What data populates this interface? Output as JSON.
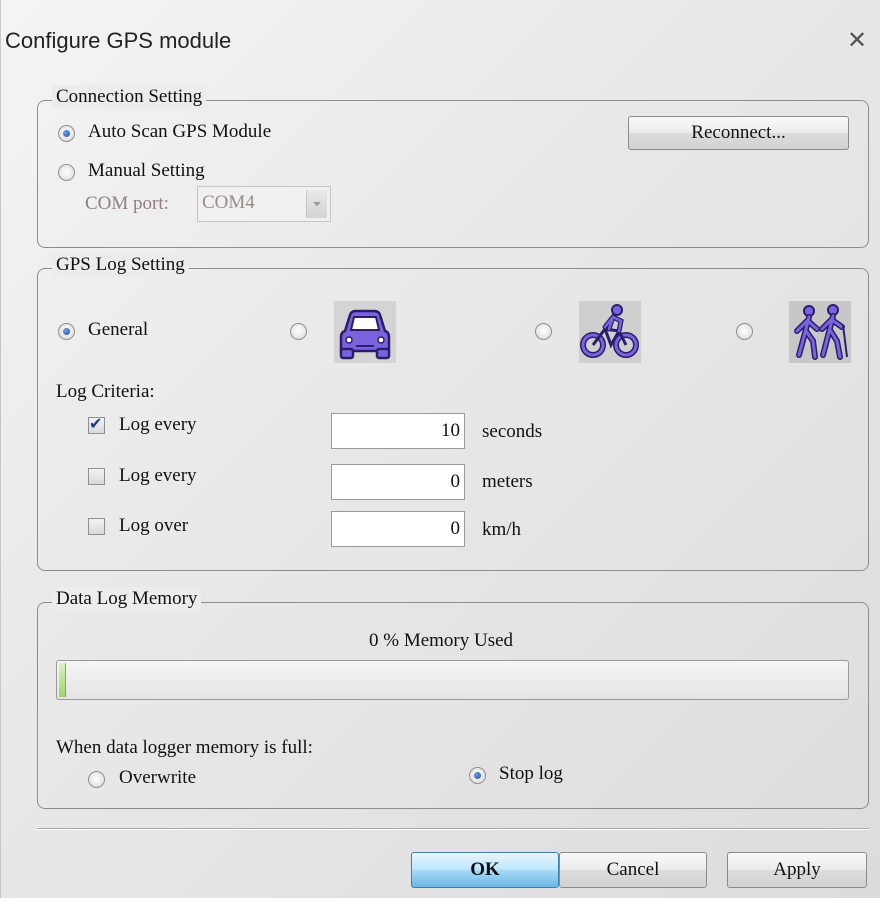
{
  "window": {
    "title": "Configure GPS module",
    "close_glyph": "✕"
  },
  "connection": {
    "legend": "Connection Setting",
    "auto_scan_label": "Auto Scan GPS Module",
    "auto_scan_selected": true,
    "manual_label": "Manual Setting",
    "manual_selected": false,
    "com_port_label": "COM port:",
    "com_port_value": "COM4",
    "reconnect_label": "Reconnect..."
  },
  "log_setting": {
    "legend": "GPS Log Setting",
    "modes": [
      {
        "label": "General",
        "icon": "general",
        "selected": true
      },
      {
        "label": "",
        "icon": "car-icon",
        "selected": false
      },
      {
        "label": "",
        "icon": "bicycle-icon",
        "selected": false
      },
      {
        "label": "",
        "icon": "hiking-icon",
        "selected": false
      }
    ],
    "criteria_label": "Log Criteria:",
    "criteria": [
      {
        "label": "Log every",
        "checked": true,
        "value": "10",
        "unit": "seconds"
      },
      {
        "label": "Log every",
        "checked": false,
        "value": "0",
        "unit": "meters"
      },
      {
        "label": "Log over",
        "checked": false,
        "value": "0",
        "unit": "km/h"
      }
    ]
  },
  "memory": {
    "legend": "Data Log Memory",
    "usage_text": "0 % Memory Used",
    "usage_percent": 0,
    "full_label": "When data logger memory is full:",
    "overwrite_label": "Overwrite",
    "overwrite_selected": false,
    "stop_label": "Stop log",
    "stop_selected": true
  },
  "buttons": {
    "ok": "OK",
    "cancel": "Cancel",
    "apply": "Apply"
  },
  "colors": {
    "icon_purple": "#7b63e0",
    "icon_bg": "#c9c9c9"
  }
}
